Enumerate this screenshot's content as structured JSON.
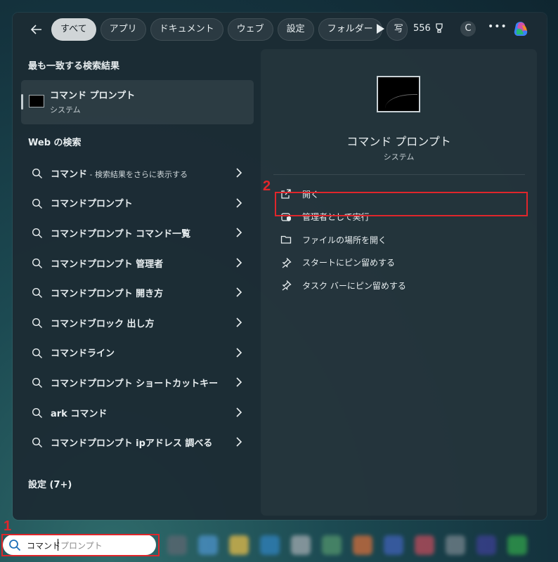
{
  "topbar": {
    "back_icon": "arrow-left-icon",
    "filters": [
      "すべて",
      "アプリ",
      "ドキュメント",
      "ウェブ",
      "設定",
      "フォルダー",
      "写"
    ],
    "active_filter": "すべて",
    "points": "556",
    "avatar_letter": "C",
    "more": "•••"
  },
  "left": {
    "best_match_heading": "最も一致する検索結果",
    "best_match": {
      "title": "コマンド プロンプト",
      "subtitle": "システム"
    },
    "web_heading": "Web の検索",
    "web_results": [
      {
        "label": "コマンド",
        "hint": " - 検索結果をさらに表示する"
      },
      {
        "label": "コマンドプロンプト",
        "hint": ""
      },
      {
        "label": "コマンドプロンプト コマンド一覧",
        "hint": ""
      },
      {
        "label": "コマンドプロンプト 管理者",
        "hint": ""
      },
      {
        "label": "コマンドプロンプト 開き方",
        "hint": ""
      },
      {
        "label": "コマンドブロック 出し方",
        "hint": ""
      },
      {
        "label": "コマンドライン",
        "hint": ""
      },
      {
        "label": "コマンドプロンプト ショートカットキー",
        "hint": ""
      },
      {
        "label": "ark コマンド",
        "hint": ""
      },
      {
        "label": "コマンドプロンプト ipアドレス 調べる",
        "hint": ""
      }
    ],
    "settings_heading": "設定 (7+)"
  },
  "right": {
    "title": "コマンド プロンプト",
    "subtitle": "システム",
    "actions": [
      {
        "label": "開く",
        "icon": "open-external-icon"
      },
      {
        "label": "管理者として実行",
        "icon": "shield-admin-icon"
      },
      {
        "label": "ファイルの場所を開く",
        "icon": "folder-icon"
      },
      {
        "label": "スタートにピン留めする",
        "icon": "pin-icon"
      },
      {
        "label": "タスク バーにピン留めする",
        "icon": "pin-icon"
      }
    ]
  },
  "annotations": {
    "step1": "1",
    "step2": "2",
    "color": "#e0262b"
  },
  "taskbar": {
    "search_typed": "コマンド",
    "search_suggestion": "プロンプト"
  }
}
